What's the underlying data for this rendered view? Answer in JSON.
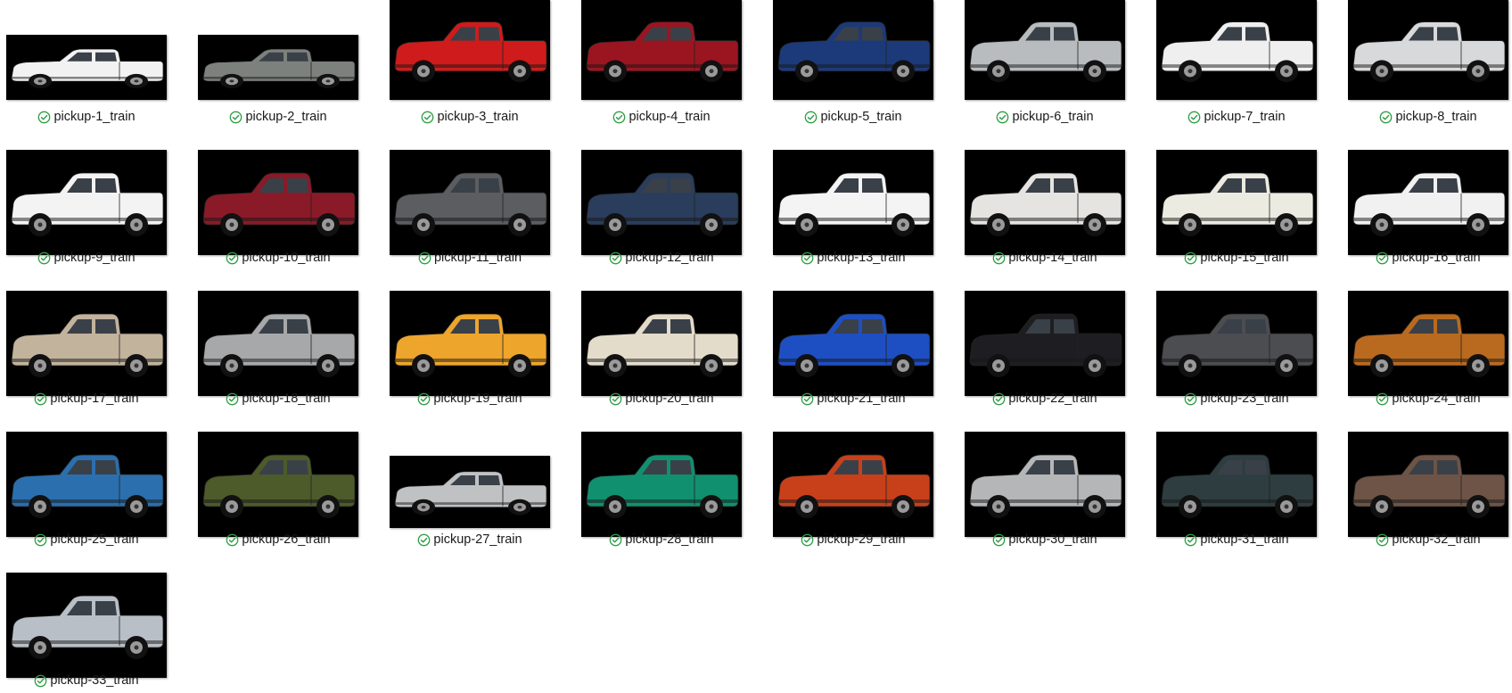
{
  "status_icon": "synced-check-icon",
  "accent_color": "#2e9e44",
  "thumbnail_background": "#000000",
  "files": [
    {
      "name": "pickup-1_train",
      "color": "#f2f2f2",
      "status": "synced"
    },
    {
      "name": "pickup-2_train",
      "color": "#7c817d",
      "status": "synced"
    },
    {
      "name": "pickup-3_train",
      "color": "#cf1b1b",
      "status": "synced"
    },
    {
      "name": "pickup-4_train",
      "color": "#9b1520",
      "status": "synced"
    },
    {
      "name": "pickup-5_train",
      "color": "#1c3a7a",
      "status": "synced"
    },
    {
      "name": "pickup-6_train",
      "color": "#b8bcbf",
      "status": "synced"
    },
    {
      "name": "pickup-7_train",
      "color": "#efefef",
      "status": "synced"
    },
    {
      "name": "pickup-8_train",
      "color": "#d8d9db",
      "status": "synced"
    },
    {
      "name": "pickup-9_train",
      "color": "#f3f3f3",
      "status": "synced"
    },
    {
      "name": "pickup-10_train",
      "color": "#8a1a28",
      "status": "synced"
    },
    {
      "name": "pickup-11_train",
      "color": "#5b5d60",
      "status": "synced"
    },
    {
      "name": "pickup-12_train",
      "color": "#2a3d5c",
      "status": "synced"
    },
    {
      "name": "pickup-13_train",
      "color": "#f4f4f4",
      "status": "synced"
    },
    {
      "name": "pickup-14_train",
      "color": "#e6e4e0",
      "status": "synced"
    },
    {
      "name": "pickup-15_train",
      "color": "#ecebe1",
      "status": "synced"
    },
    {
      "name": "pickup-16_train",
      "color": "#f1f1f1",
      "status": "synced"
    },
    {
      "name": "pickup-17_train",
      "color": "#c2b39c",
      "status": "synced"
    },
    {
      "name": "pickup-18_train",
      "color": "#a6a8aa",
      "status": "synced"
    },
    {
      "name": "pickup-19_train",
      "color": "#eea52c",
      "status": "synced"
    },
    {
      "name": "pickup-20_train",
      "color": "#e4dccb",
      "status": "synced"
    },
    {
      "name": "pickup-21_train",
      "color": "#1e4fc2",
      "status": "synced"
    },
    {
      "name": "pickup-22_train",
      "color": "#1e1e22",
      "status": "synced"
    },
    {
      "name": "pickup-23_train",
      "color": "#4b4d50",
      "status": "synced"
    },
    {
      "name": "pickup-24_train",
      "color": "#b96a1f",
      "status": "synced"
    },
    {
      "name": "pickup-25_train",
      "color": "#2b6fae",
      "status": "synced"
    },
    {
      "name": "pickup-26_train",
      "color": "#4d5a2a",
      "status": "synced"
    },
    {
      "name": "pickup-27_train",
      "color": "#bfc1c3",
      "status": "synced"
    },
    {
      "name": "pickup-28_train",
      "color": "#119070",
      "status": "synced"
    },
    {
      "name": "pickup-29_train",
      "color": "#c8401a",
      "status": "synced"
    },
    {
      "name": "pickup-30_train",
      "color": "#b4b6b8",
      "status": "synced"
    },
    {
      "name": "pickup-31_train",
      "color": "#2e3d40",
      "status": "synced"
    },
    {
      "name": "pickup-32_train",
      "color": "#6e5446",
      "status": "synced"
    },
    {
      "name": "pickup-33_train",
      "color": "#b9bfc6",
      "status": "synced"
    }
  ]
}
